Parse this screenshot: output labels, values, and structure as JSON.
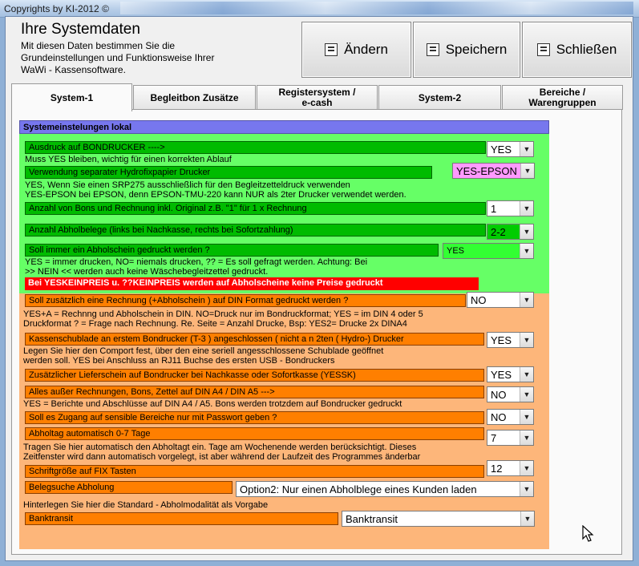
{
  "window": {
    "title": "Copyrights by KI-2012 ©"
  },
  "header": {
    "title": "Ihre Systemdaten",
    "description": "Mit diesen Daten bestimmen Sie die\nGrundeinstellungen und Funktionsweise Ihrer\nWaWi - Kassensoftware."
  },
  "toolbar": {
    "change_label": "Ändern",
    "save_label": "Speichern",
    "close_label": "Schließen"
  },
  "tabs": [
    {
      "label": "System-1"
    },
    {
      "label": "Begleitbon Zusätze"
    },
    {
      "label": "Registersystem /\ne-cash"
    },
    {
      "label": "System-2"
    },
    {
      "label": "Bereiche /\nWarengruppen"
    }
  ],
  "section": {
    "title": "Systemeinstelungen lokal"
  },
  "settings": {
    "bondrucker": {
      "label": "Ausdruck auf BONDRUCKER  ---->",
      "value": "YES",
      "note": "Muss YES bleiben, wichtig für einen korrekten Ablauf"
    },
    "hydrofix": {
      "label": "Verwendung separater Hydrofixpapier Drucker",
      "value": "YES-EPSON",
      "note": "YES, Wenn Sie einen SRP275 ausschließlich für den Begleitzetteldruck verwenden\nYES-EPSON bei EPSON, denn EPSON-TMU-220  kann NUR als 2ter Drucker verwendet werden."
    },
    "anzahl_bons": {
      "label": "Anzahl von Bons und  Rechnung inkl. Original z.B. \"1\"  für 1 x Rechnung",
      "value": "1"
    },
    "abholbelege": {
      "label": "Anzahl Abholbelege  (links bei Nachkasse, rechts bei Sofortzahlung)",
      "value": "2-2"
    },
    "abholschein": {
      "label": "Soll  immer ein Abholschein gedruckt werden ?",
      "value": "YES",
      "note": "YES = immer drucken, NO= niemals drucken, ?? = Es soll gefragt werden. Achtung: Bei\n>> NEIN <<  werden  auch keine Wäschebegleitzettel gedruckt.",
      "warning": "Bei YESKEINPREIS u. ??KEINPREIS werden auf Abholscheine keine Preise gedruckt"
    },
    "din_format": {
      "label": "Soll zusätzlich eine Rechnung (+Abholschein ) auf DIN Format gedruckt werden ?",
      "value": "NO",
      "note": "YES+A = Rechnng und Abholschein in DIN. NO=Druck nur im Bondruckformat;  YES = im DIN 4 oder 5\nDruckformat  ? = Frage nach Rechnung. Re. Seite = Anzahl Drucke, Bsp: YES2= Drucke 2x  DINA4"
    },
    "kassenschublade": {
      "label": "Kassenschublade an erstem Bondrucker (T-3 ) angeschlossen ( nicht a n 2ten ( Hydro-) Drucker",
      "value": "YES",
      "note": "Legen Sie hier den Comport fest, über den eine seriell angesschlossene Schublade geöffnet\nwerden soll. YES bei Anschluss an RJ11 Buchse des ersten USB - Bondruckers"
    },
    "lieferschein": {
      "label": "Zusätzlicher Lieferschein auf Bondrucker bei Nachkasse  oder Sofortkasse (YESSK)",
      "value": "YES"
    },
    "din_a4": {
      "label": "Alles außer Rechnungen, Bons, Zettel auf DIN A4  / DIN A5      --->",
      "value": "NO",
      "note": "YES = Berichte und Abschlüsse auf DIN A4 / A5.  Bons werden trotzdem auf Bondrucker gedruckt"
    },
    "passwort": {
      "label": "Soll es Zugang auf sensible Bereiche nur mit Passwort geben ?",
      "value": "NO"
    },
    "abholtag": {
      "label": "Abholtag automatisch 0-7 Tage",
      "value": "7",
      "note": "Tragen Sie hier automatisch den Abholtagt ein. Tage am Wochenende werden berücksichtigt. Dieses\nZeitfenster wird dann automatisch vorgelegt, ist aber während der Laufzeit des Programmes änderbar"
    },
    "schriftgroesse": {
      "label": "Schriftgröße auf FIX Tasten",
      "value": "12"
    },
    "belegsuche": {
      "label": "Belegsuche Abholung",
      "value": "Option2: Nur einen Abholblege eines Kunden laden",
      "note": "Hinterlegen Sie hier die Standard - Abholmodalität als Vorgabe"
    },
    "banktransit": {
      "label": "Banktransit",
      "value": "Banktransit"
    }
  },
  "colors": {
    "green_panel": "#66ff66",
    "green_label": "#00bb00",
    "orange_panel": "#fdb67a",
    "orange_label": "#ff7f00",
    "section_header": "#7777ee",
    "warning": "#ff0000",
    "epson_highlight": "#ff99ff",
    "abhol_highlight": "#33ff33"
  },
  "icons": {
    "change": "edit-icon",
    "save": "save-icon",
    "close": "exit-icon",
    "dropdown": "chevron-down-icon",
    "cursor": "mouse-pointer-icon"
  }
}
